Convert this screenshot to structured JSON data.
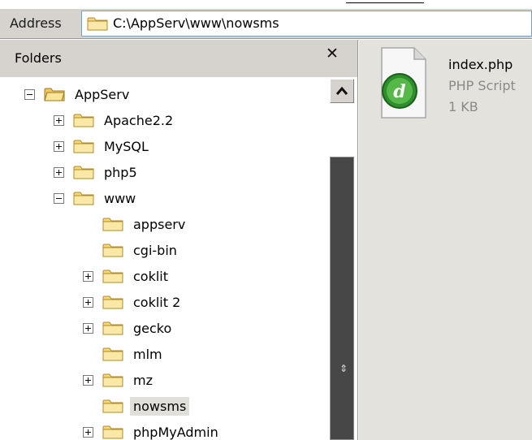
{
  "address_bar": {
    "label": "Address",
    "path": "C:\\AppServ\\www\\nowsms",
    "folder_icon": "folder-icon"
  },
  "folders_pane": {
    "title": "Folders",
    "close_icon": "close-icon",
    "tree": [
      {
        "label": "AppServ",
        "expander": "minus",
        "icon": "folder-open-icon"
      },
      {
        "label": "Apache2.2",
        "expander": "plus",
        "icon": "folder-icon"
      },
      {
        "label": "MySQL",
        "expander": "plus",
        "icon": "folder-icon"
      },
      {
        "label": "php5",
        "expander": "plus",
        "icon": "folder-icon"
      },
      {
        "label": "www",
        "expander": "minus",
        "icon": "folder-icon"
      },
      {
        "label": "appserv",
        "expander": "none",
        "icon": "folder-icon"
      },
      {
        "label": "cgi-bin",
        "expander": "none",
        "icon": "folder-icon"
      },
      {
        "label": "coklit",
        "expander": "plus",
        "icon": "folder-icon"
      },
      {
        "label": "coklit 2",
        "expander": "plus",
        "icon": "folder-icon"
      },
      {
        "label": "gecko",
        "expander": "plus",
        "icon": "folder-icon"
      },
      {
        "label": "mlm",
        "expander": "none",
        "icon": "folder-icon"
      },
      {
        "label": "mz",
        "expander": "plus",
        "icon": "folder-icon"
      },
      {
        "label": "nowsms",
        "expander": "none",
        "icon": "folder-icon",
        "selected": true
      },
      {
        "label": "phpMyAdmin",
        "expander": "plus",
        "icon": "folder-icon"
      }
    ]
  },
  "file_pane": {
    "files": [
      {
        "name": "index.php",
        "type": "PHP Script",
        "size": "1 KB",
        "icon": "dreamweaver-php-file-icon"
      }
    ]
  },
  "colors": {
    "toolbar_bg": "#d6d3ce",
    "right_pane_bg": "#e4e2dc",
    "folder_yellow": "#f4d57e",
    "scroll_thumb": "#474747"
  }
}
